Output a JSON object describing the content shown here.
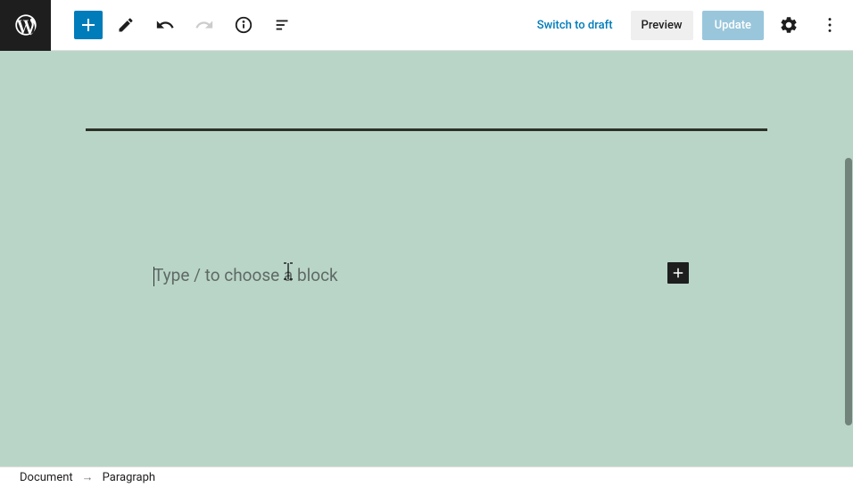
{
  "toolbar": {
    "switch_to_draft_label": "Switch to draft",
    "preview_label": "Preview",
    "update_label": "Update"
  },
  "editor": {
    "paragraph_placeholder": "Type / to choose a block"
  },
  "breadcrumb": {
    "item1": "Document",
    "arrow": "→",
    "item2": "Paragraph"
  },
  "icons": {
    "wordpress": "wordpress-logo",
    "add": "plus-icon",
    "edit": "pencil-icon",
    "undo": "undo-icon",
    "redo": "redo-icon",
    "info": "info-icon",
    "outline": "list-icon",
    "settings": "gear-icon",
    "more": "more-vertical-icon",
    "block_add": "plus-icon"
  }
}
